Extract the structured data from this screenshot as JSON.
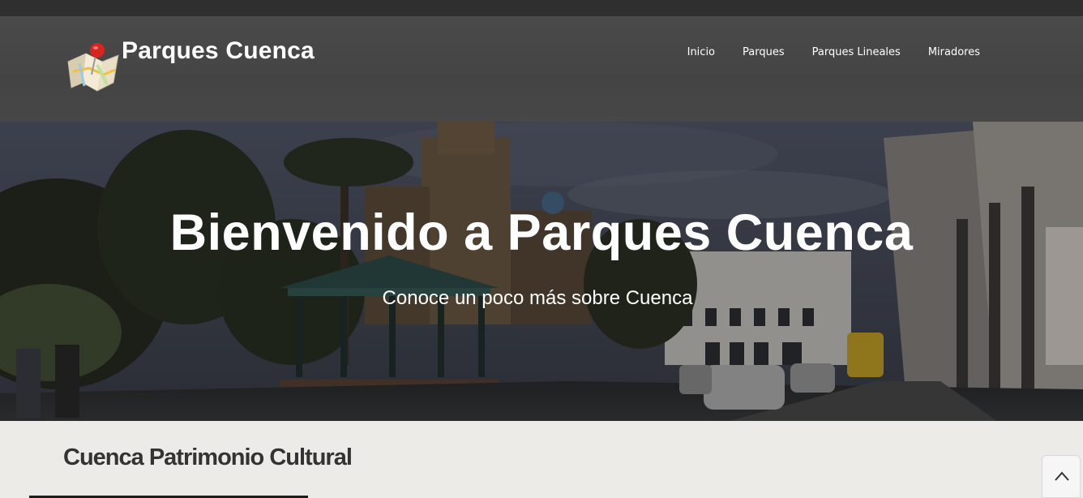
{
  "header": {
    "site_title": "Parques Cuenca",
    "logo_icon": "map-pin-icon",
    "nav": [
      {
        "label": "Inicio"
      },
      {
        "label": "Parques"
      },
      {
        "label": "Parques Lineales"
      },
      {
        "label": "Miradores"
      }
    ]
  },
  "hero": {
    "title": "Bienvenido a Parques Cuenca",
    "subtitle": "Conoce un poco más sobre Cuenca"
  },
  "main": {
    "section_title": "Cuenca Patrimonio Cultural"
  },
  "scroll_top": {
    "icon": "chevron-up-icon"
  },
  "colors": {
    "header_bg": "#474747",
    "top_strip": "#2f2f2f",
    "content_bg": "#ecebe8",
    "text_dark": "#333333"
  }
}
